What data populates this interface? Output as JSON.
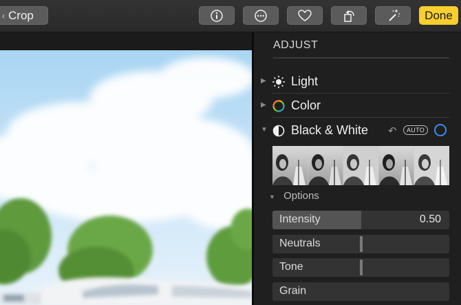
{
  "toolbar": {
    "crop_label": "Crop",
    "info_icon": "info-icon",
    "more_icon": "ellipsis-icon",
    "favorite_icon": "heart-icon",
    "rotate_icon": "rotate-icon",
    "enhance_icon": "magic-wand-icon",
    "done_label": "Done"
  },
  "panel": {
    "title": "ADJUST",
    "sections": [
      {
        "label": "Light",
        "icon": "sun-icon",
        "expanded": false
      },
      {
        "label": "Color",
        "icon": "color-wheel-icon",
        "expanded": false
      },
      {
        "label": "Black & White",
        "icon": "half-circle-icon",
        "expanded": true
      }
    ],
    "bw": {
      "revert_icon": "revert-icon",
      "auto_label": "AUTO",
      "toggle_icon": "toggle-circle-icon",
      "thumbnail_count": 5
    },
    "options_label": "Options",
    "sliders": [
      {
        "label": "Intensity",
        "value": "0.50",
        "fraction": 0.5
      },
      {
        "label": "Neutrals",
        "value": "",
        "fraction": 0.5
      },
      {
        "label": "Tone",
        "value": "",
        "fraction": 0.5
      },
      {
        "label": "Grain",
        "value": "",
        "fraction": 0
      }
    ]
  },
  "colors": {
    "accent_done": "#f7cf2f",
    "toggle_blue": "#3b8ff2",
    "panel_bg": "#1f1f1f"
  }
}
